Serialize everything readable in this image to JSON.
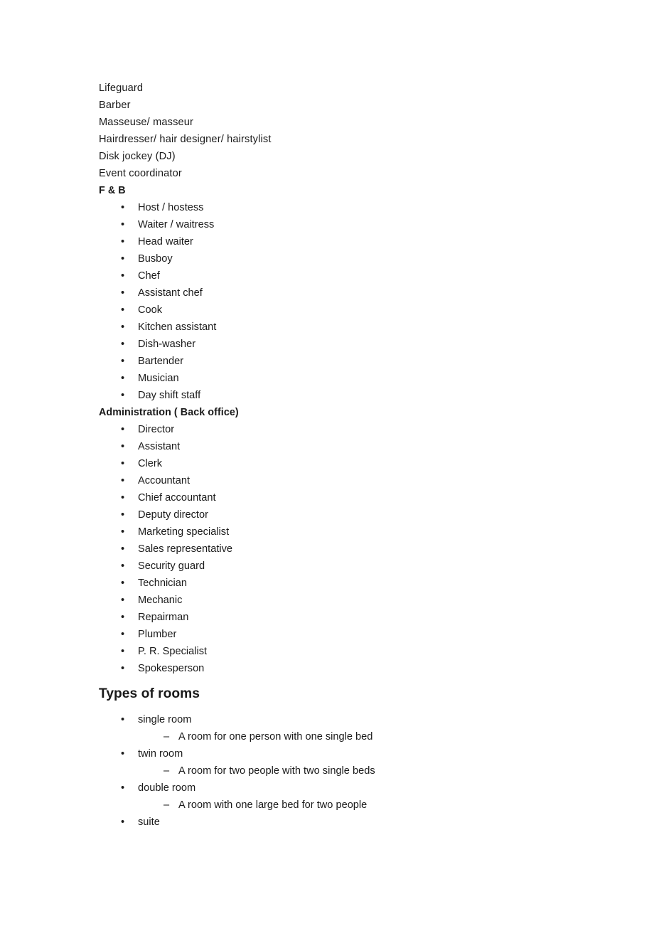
{
  "document": {
    "background_color": "#ffffff",
    "text_color": "#1a1a1a",
    "blocks": [
      {
        "type": "para",
        "text": "Lifeguard"
      },
      {
        "type": "para",
        "text": "Barber"
      },
      {
        "type": "para",
        "text": "Masseuse/ masseur"
      },
      {
        "type": "para",
        "text": "Hairdresser/ hair designer/ hairstylist"
      },
      {
        "type": "para",
        "text": "Disk jockey (DJ)"
      },
      {
        "type": "para",
        "text": "Event coordinator"
      },
      {
        "type": "subhead",
        "text": "F & B"
      },
      {
        "type": "li1",
        "marker": "•",
        "text": "Host / hostess"
      },
      {
        "type": "li1",
        "marker": "•",
        "text": "Waiter / waitress"
      },
      {
        "type": "li1",
        "marker": "•",
        "text": "Head waiter"
      },
      {
        "type": "li1",
        "marker": "•",
        "text": "Busboy"
      },
      {
        "type": "li1",
        "marker": "•",
        "text": "Chef"
      },
      {
        "type": "li1",
        "marker": "•",
        "text": "Assistant chef"
      },
      {
        "type": "li1",
        "marker": "•",
        "text": "Cook"
      },
      {
        "type": "li1",
        "marker": "•",
        "text": "Kitchen assistant"
      },
      {
        "type": "li1",
        "marker": "•",
        "text": "Dish-washer"
      },
      {
        "type": "li1",
        "marker": "•",
        "text": "Bartender"
      },
      {
        "type": "li1",
        "marker": "•",
        "text": "Musician"
      },
      {
        "type": "li1",
        "marker": "•",
        "text": "Day shift staff"
      },
      {
        "type": "subhead",
        "text": "Administration ( Back office)"
      },
      {
        "type": "li1",
        "marker": "•",
        "text": "Director"
      },
      {
        "type": "li1",
        "marker": "•",
        "text": "Assistant"
      },
      {
        "type": "li1",
        "marker": "•",
        "text": "Clerk"
      },
      {
        "type": "li1",
        "marker": "•",
        "text": "Accountant"
      },
      {
        "type": "li1",
        "marker": "•",
        "text": "Chief accountant"
      },
      {
        "type": "li1",
        "marker": "•",
        "text": "Deputy director"
      },
      {
        "type": "li1",
        "marker": "•",
        "text": "Marketing specialist"
      },
      {
        "type": "li1",
        "marker": "•",
        "text": "Sales representative"
      },
      {
        "type": "li1",
        "marker": "•",
        "text": "Security guard"
      },
      {
        "type": "li1",
        "marker": "•",
        "text": "Technician"
      },
      {
        "type": "li1",
        "marker": "•",
        "text": "Mechanic"
      },
      {
        "type": "li1",
        "marker": "•",
        "text": "Repairman"
      },
      {
        "type": "li1",
        "marker": "•",
        "text": "Plumber"
      },
      {
        "type": "li1",
        "marker": "•",
        "text": "P. R. Specialist"
      },
      {
        "type": "li1",
        "marker": "•",
        "text": "Spokesperson"
      },
      {
        "type": "heading",
        "text": "Types of rooms"
      },
      {
        "type": "li1",
        "marker": "•",
        "text": "single room"
      },
      {
        "type": "li2",
        "marker": "–",
        "text": "A room for one person with one single bed"
      },
      {
        "type": "li1",
        "marker": "•",
        "text": "twin room"
      },
      {
        "type": "li2",
        "marker": "–",
        "text": "A room for two people with two single beds"
      },
      {
        "type": "li1",
        "marker": "•",
        "text": "double room"
      },
      {
        "type": "li2",
        "marker": "–",
        "text": "A room with one large bed for two people"
      },
      {
        "type": "li1",
        "marker": "•",
        "text": "suite"
      }
    ]
  }
}
